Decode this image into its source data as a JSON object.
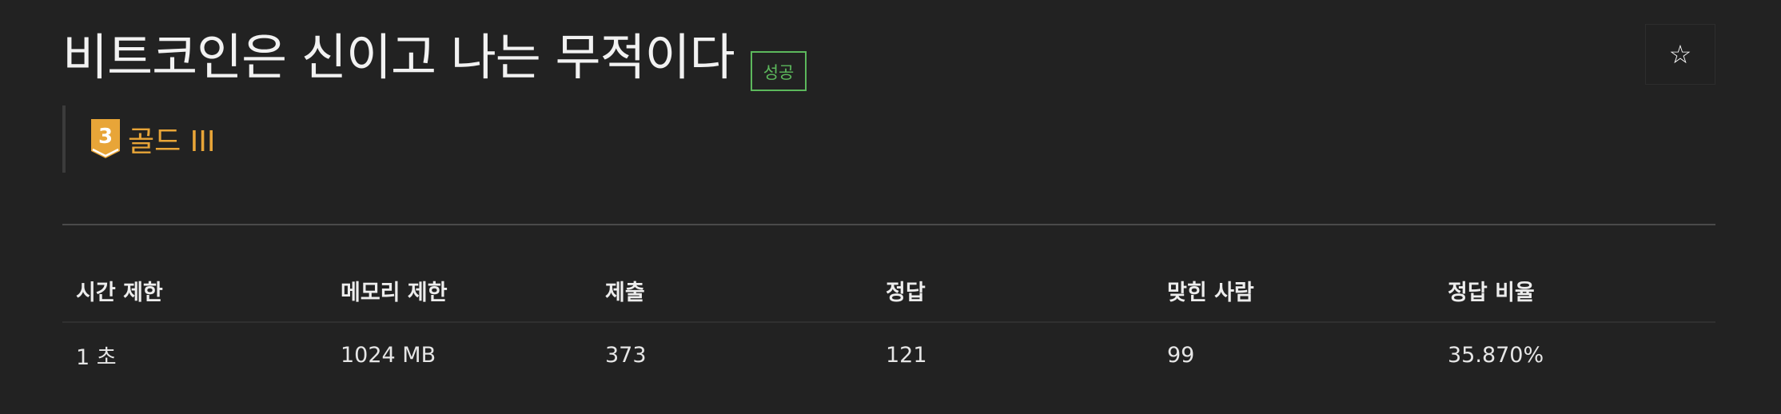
{
  "problem": {
    "title": "비트코인은 신이고 나는 무적이다",
    "status_badge": "성공",
    "favorite_icon": "star-outline-icon",
    "tier": {
      "number": "3",
      "label": "골드 III",
      "color": "#e8a538"
    }
  },
  "stats": {
    "headers": [
      "시간 제한",
      "메모리 제한",
      "제출",
      "정답",
      "맞힌 사람",
      "정답 비율"
    ],
    "row": [
      "1 초",
      "1024 MB",
      "373",
      "121",
      "99",
      "35.870%"
    ]
  },
  "colors": {
    "background": "#222222",
    "success": "#5cb85c",
    "gold": "#e8a538"
  }
}
